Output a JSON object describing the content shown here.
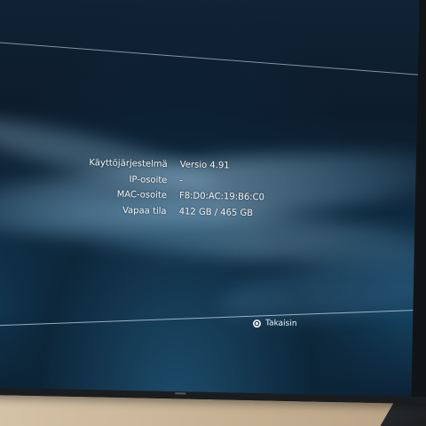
{
  "system_info": {
    "rows": [
      {
        "label": "Käyttöjärjestelmä",
        "value": "Versio 4.91"
      },
      {
        "label": "IP-osoite",
        "value": "-"
      },
      {
        "label": "MAC-osoite",
        "value": "F8:D0:AC:19:B6:C0"
      },
      {
        "label": "Vapaa tila",
        "value": "412 GB / 465 GB"
      }
    ]
  },
  "footer": {
    "back_icon": "circle-button-icon",
    "back_label": "Takaisin"
  },
  "colors": {
    "text": "#f2f5f8",
    "background_dark": "#102235",
    "wave_highlight": "#a0c8e1"
  }
}
